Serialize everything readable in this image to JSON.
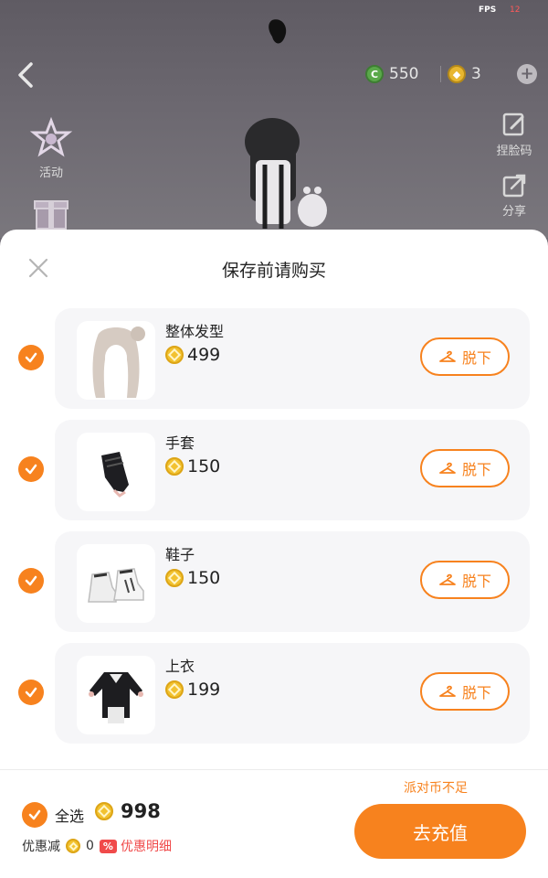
{
  "overlay": {
    "fps_label": "FPS",
    "fps_value": "12",
    "currency_green": "550",
    "currency_gold": "3",
    "left_menu": [
      {
        "label": "活动",
        "icon": "star-badge-icon"
      },
      {
        "label": "",
        "icon": "gift-box-icon"
      }
    ],
    "right_menu": [
      {
        "label": "捏脸码",
        "icon": "edit-icon"
      },
      {
        "label": "分享",
        "icon": "share-icon"
      }
    ]
  },
  "dialog": {
    "title": "保存前请购买",
    "items": [
      {
        "name": "整体发型",
        "price": "499",
        "action": "脱下",
        "checked": true,
        "icon": "hairstyle-icon"
      },
      {
        "name": "手套",
        "price": "150",
        "action": "脱下",
        "checked": true,
        "icon": "glove-icon"
      },
      {
        "name": "鞋子",
        "price": "150",
        "action": "脱下",
        "checked": true,
        "icon": "sneaker-icon"
      },
      {
        "name": "上衣",
        "price": "199",
        "action": "脱下",
        "checked": true,
        "icon": "jacket-icon"
      }
    ],
    "footer": {
      "select_all_label": "全选",
      "total": "998",
      "discount_label": "优惠减",
      "discount_value": "0",
      "discount_badge": "%",
      "discount_link": "优惠明细",
      "insufficient": "派对币不足",
      "recharge_label": "去充值"
    }
  },
  "colors": {
    "accent": "#f7821e",
    "coin": "#f2c230",
    "discount_red": "#f04a4a"
  }
}
